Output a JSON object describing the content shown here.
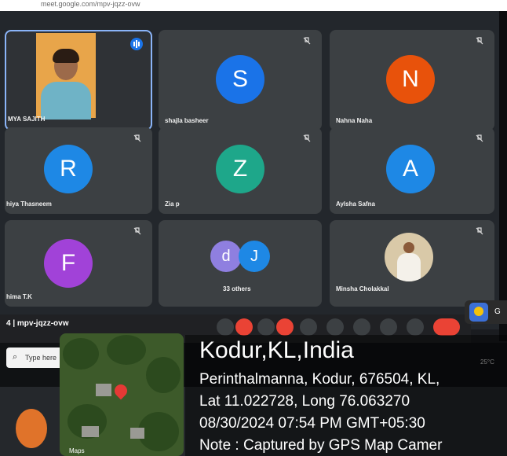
{
  "browser": {
    "url_text": "meet.google.com/mpv-jqzz-ovw"
  },
  "participants": [
    {
      "name": "MYA SAJITH",
      "type": "video",
      "speaking": true
    },
    {
      "name": "shajla basheer",
      "initial": "S",
      "color": "#1a73e8"
    },
    {
      "name": "Nahna Naha",
      "initial": "N",
      "color": "#e8520b"
    },
    {
      "name": "hiya Thasneem",
      "initial": "R",
      "color": "#1e88e5"
    },
    {
      "name": "Zia p",
      "initial": "Z",
      "color": "#1ea78a"
    },
    {
      "name": "Aylsha Safna",
      "initial": "A",
      "color": "#1e88e5"
    },
    {
      "name": "hima T.K",
      "initial": "F",
      "color": "#a142d8"
    },
    {
      "name": "33 others",
      "initial_a": "d",
      "initial_b": "J",
      "color_a": "#8f7fe0",
      "color_b": "#1e88e5"
    },
    {
      "name": "Minsha Cholakkal",
      "type": "photo"
    }
  ],
  "meeting": {
    "code": "| mpv-jqzz-ovw",
    "code_prefix": "4"
  },
  "taskbar": {
    "search_placeholder": "Type here",
    "temperature": "25°C"
  },
  "gps": {
    "title": "Kodur,KL,India",
    "address": "Perinthalmanna, Kodur, 676504, KL,",
    "coords": "Lat 11.022728, Long 76.063270",
    "datetime": "08/30/2024 07:54 PM GMT+05:30",
    "note": "Note : Captured by GPS Map Camer",
    "map_label": "Maps",
    "app_icon_letter": "G"
  }
}
